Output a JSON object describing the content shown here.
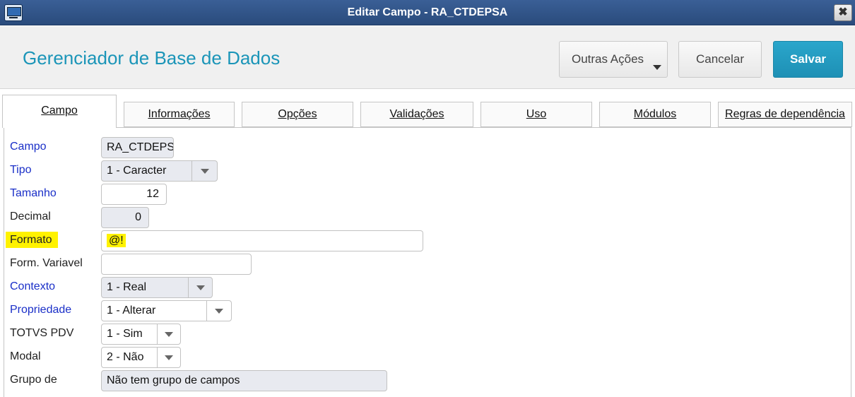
{
  "window": {
    "title": "Editar Campo - RA_CTDEPSA",
    "close_label": "✖"
  },
  "header": {
    "brand": "Gerenciador de Base de Dados",
    "buttons": {
      "outras": "Outras Ações",
      "cancelar": "Cancelar",
      "salvar": "Salvar"
    }
  },
  "tabs": [
    {
      "label": "Campo",
      "active": true
    },
    {
      "label": "Informações"
    },
    {
      "label": "Opções"
    },
    {
      "label": "Validações"
    },
    {
      "label": "Uso"
    },
    {
      "label": "Módulos"
    },
    {
      "label": "Regras de dependência"
    }
  ],
  "form": {
    "campo": {
      "label": "Campo",
      "value": "RA_CTDEPSA"
    },
    "tipo": {
      "label": "Tipo",
      "value": "1 - Caracter"
    },
    "tamanho": {
      "label": "Tamanho",
      "value": "12"
    },
    "decimal": {
      "label": "Decimal",
      "value": "0"
    },
    "formato": {
      "label": "Formato",
      "value": "@!"
    },
    "form_variavel": {
      "label": "Form. Variavel",
      "value": ""
    },
    "contexto": {
      "label": "Contexto",
      "value": "1 - Real"
    },
    "propriedade": {
      "label": "Propriedade",
      "value": "1 - Alterar"
    },
    "totvs_pdv": {
      "label": "TOTVS PDV",
      "value": "1 - Sim"
    },
    "modal": {
      "label": "Modal",
      "value": "2 - Não"
    },
    "grupo": {
      "label": "Grupo de",
      "value": "Não tem grupo de campos"
    }
  },
  "colors": {
    "title_bar": "#2f5386",
    "brand": "#1b95b8",
    "primary_button": "#2aa6cb",
    "required_label": "#1a2fc8",
    "highlight": "#fff200"
  }
}
